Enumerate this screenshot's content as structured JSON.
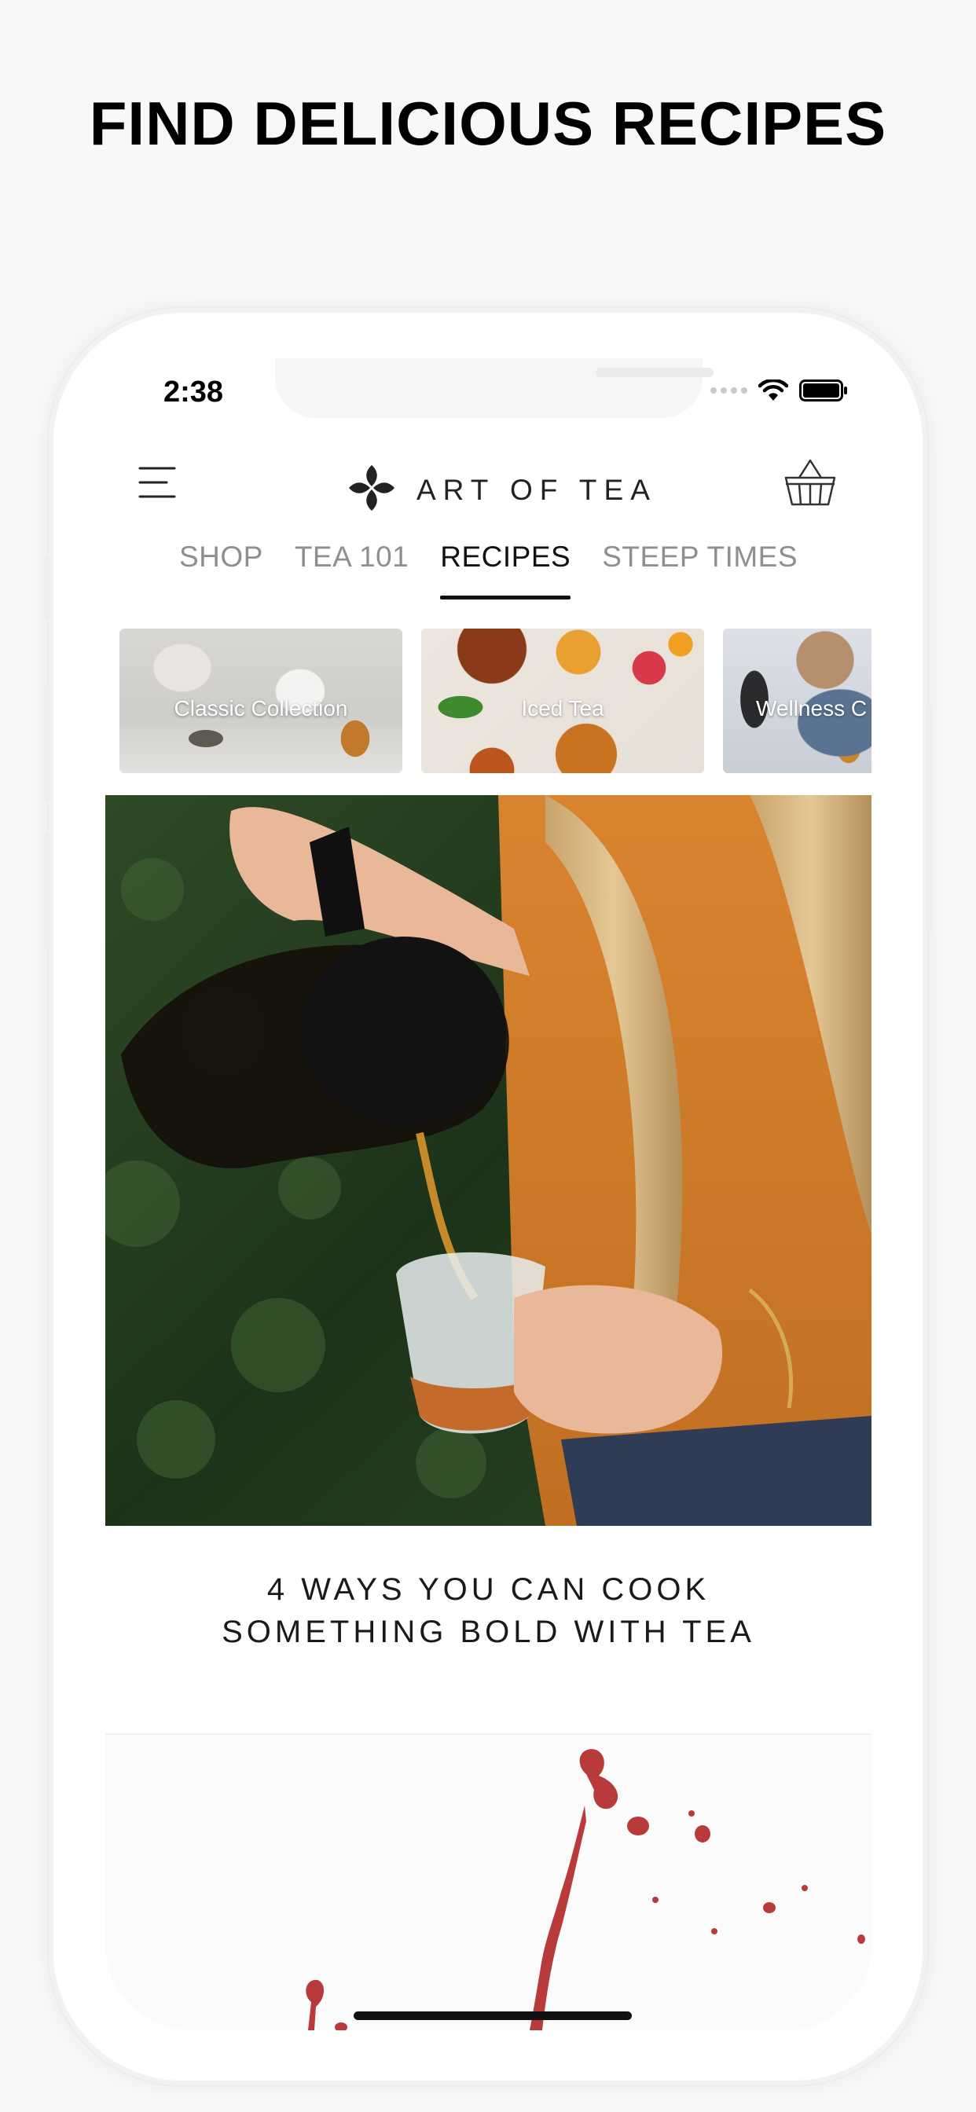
{
  "marketing": {
    "headline": "FIND DELICIOUS RECIPES"
  },
  "status_bar": {
    "time": "2:38"
  },
  "header": {
    "brand_name": "ART OF TEA"
  },
  "tabs": [
    {
      "label": "SHOP",
      "active": false
    },
    {
      "label": "TEA 101",
      "active": false
    },
    {
      "label": "RECIPES",
      "active": true
    },
    {
      "label": "STEEP TIMES",
      "active": false
    }
  ],
  "categories": [
    {
      "label": "Classic Collection"
    },
    {
      "label": "Iced Tea"
    },
    {
      "label": "Wellness C"
    }
  ],
  "article": {
    "title_line1": "4 WAYS YOU CAN COOK",
    "title_line2": "SOMETHING BOLD WITH TEA"
  },
  "colors": {
    "background": "#f8f8f8",
    "active_tab": "#111111",
    "inactive_tab": "#8f8f8f",
    "splash_red": "#b83a3a"
  }
}
